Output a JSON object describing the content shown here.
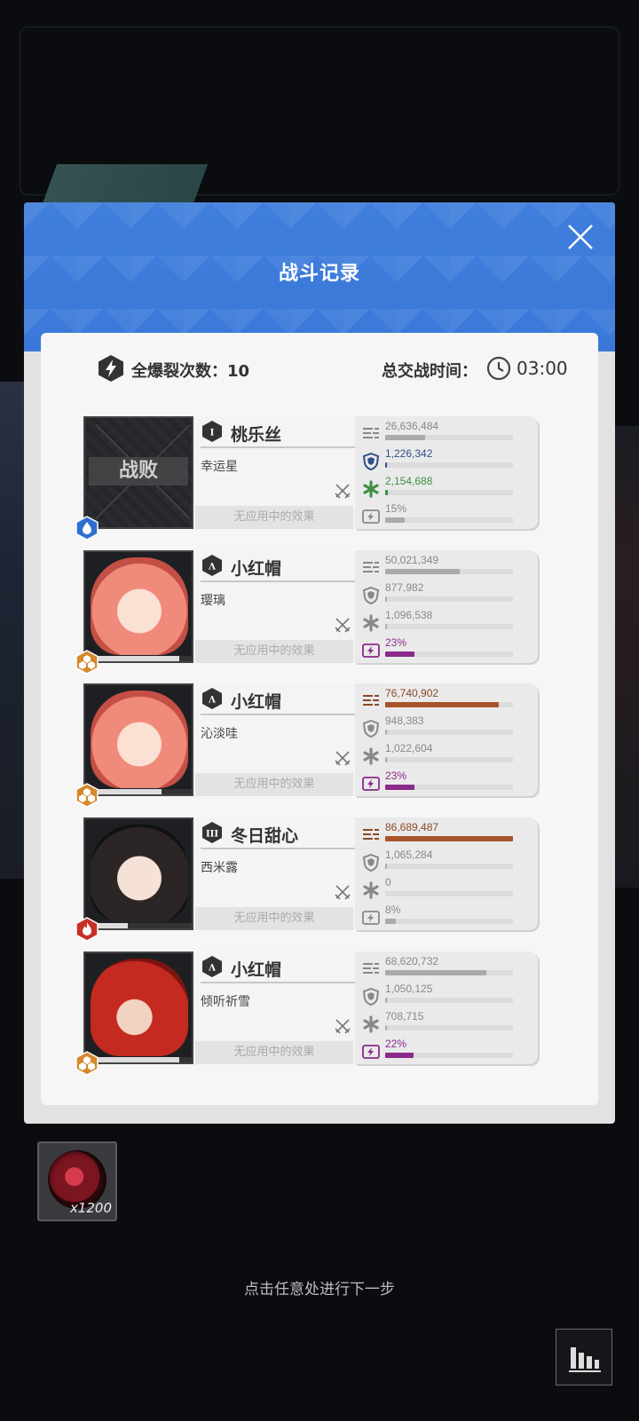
{
  "dialog": {
    "title": "战斗记录",
    "close_icon": "close-icon"
  },
  "summary": {
    "burst_label": "全爆裂次数：10",
    "total_time_label": "总交战时间：",
    "total_time_value": "03:00"
  },
  "rows": [
    {
      "rank": "I",
      "character": "桃乐丝",
      "player": "幸运星",
      "effect": "无应用中的效果",
      "defeated_label": "战败",
      "element": "water",
      "element_color": "#2e6fd0",
      "stats": [
        {
          "value": "26,636,484",
          "fill": 0.31,
          "color": "#aaaaaa",
          "icon": "damage-icon",
          "text_color": "#888888"
        },
        {
          "value": "1,226,342",
          "fill": 0.01,
          "color": "#2f4f86",
          "icon": "shield-icon",
          "text_color": "#2f4f86"
        },
        {
          "value": "2,154,688",
          "fill": 0.02,
          "color": "#3e8f42",
          "icon": "heal-icon",
          "text_color": "#3e8f42"
        },
        {
          "value": "15%",
          "fill": 0.15,
          "color": "#aaaaaa",
          "icon": "burst-icon",
          "text_color": "#888888"
        }
      ]
    },
    {
      "rank": "Λ",
      "character": "小红帽",
      "player": "璎璃",
      "effect": "无应用中的效果",
      "element": "iron",
      "element_color": "#d4892a",
      "stats": [
        {
          "value": "50,021,349",
          "fill": 0.58,
          "color": "#aaaaaa",
          "icon": "damage-icon",
          "text_color": "#888888"
        },
        {
          "value": "877,982",
          "fill": 0.01,
          "color": "#aaaaaa",
          "icon": "shield-icon",
          "text_color": "#888888"
        },
        {
          "value": "1,096,538",
          "fill": 0.01,
          "color": "#aaaaaa",
          "icon": "heal-icon",
          "text_color": "#888888"
        },
        {
          "value": "23%",
          "fill": 0.23,
          "color": "#8a2a8a",
          "icon": "burst-icon",
          "text_color": "#8a2a8a"
        }
      ]
    },
    {
      "rank": "Λ",
      "character": "小红帽",
      "player": "沁淡哇",
      "effect": "无应用中的效果",
      "element": "iron",
      "element_color": "#d4892a",
      "stats": [
        {
          "value": "76,740,902",
          "fill": 0.89,
          "color": "#a8532b",
          "icon": "damage-icon",
          "text_color": "#8a4a28"
        },
        {
          "value": "948,383",
          "fill": 0.01,
          "color": "#aaaaaa",
          "icon": "shield-icon",
          "text_color": "#888888"
        },
        {
          "value": "1,022,604",
          "fill": 0.01,
          "color": "#aaaaaa",
          "icon": "heal-icon",
          "text_color": "#888888"
        },
        {
          "value": "23%",
          "fill": 0.23,
          "color": "#8a2a8a",
          "icon": "burst-icon",
          "text_color": "#8a2a8a"
        }
      ]
    },
    {
      "rank": "III",
      "character": "冬日甜心",
      "player": "西米露",
      "effect": "无应用中的效果",
      "element": "fire",
      "element_color": "#c93028",
      "stats": [
        {
          "value": "86,689,487",
          "fill": 1.0,
          "color": "#a8532b",
          "icon": "damage-icon",
          "text_color": "#8a4a28"
        },
        {
          "value": "1,065,284",
          "fill": 0.01,
          "color": "#aaaaaa",
          "icon": "shield-icon",
          "text_color": "#888888"
        },
        {
          "value": "0",
          "fill": 0.0,
          "color": "#aaaaaa",
          "icon": "heal-icon",
          "text_color": "#888888"
        },
        {
          "value": "8%",
          "fill": 0.08,
          "color": "#aaaaaa",
          "icon": "burst-icon",
          "text_color": "#888888"
        }
      ]
    },
    {
      "rank": "Λ",
      "character": "小红帽",
      "player": "倾听祈雪",
      "effect": "无应用中的效果",
      "element": "iron",
      "element_color": "#d4892a",
      "stats": [
        {
          "value": "68,620,732",
          "fill": 0.79,
          "color": "#aaaaaa",
          "icon": "damage-icon",
          "text_color": "#888888"
        },
        {
          "value": "1,050,125",
          "fill": 0.01,
          "color": "#aaaaaa",
          "icon": "shield-icon",
          "text_color": "#888888"
        },
        {
          "value": "708,715",
          "fill": 0.01,
          "color": "#aaaaaa",
          "icon": "heal-icon",
          "text_color": "#888888"
        },
        {
          "value": "22%",
          "fill": 0.22,
          "color": "#8a2a8a",
          "icon": "burst-icon",
          "text_color": "#8a2a8a"
        }
      ]
    }
  ],
  "reward": {
    "count": "x1200"
  },
  "footer": {
    "hint": "点击任意处进行下一步",
    "stats_button_icon": "bar-chart-icon"
  }
}
